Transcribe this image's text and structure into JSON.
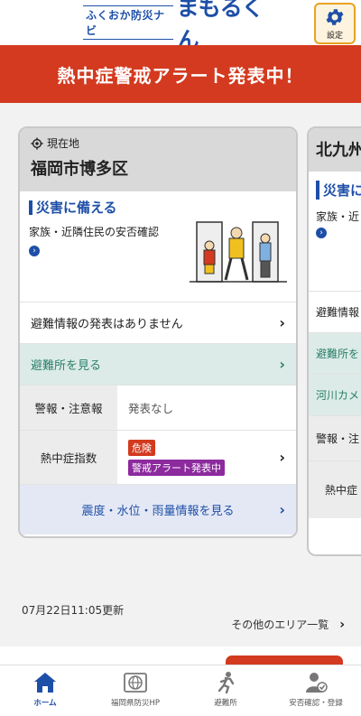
{
  "header": {
    "logo_sub": "ふくおか防災ナビ",
    "logo_main": "まもるくん",
    "settings_label": "設定"
  },
  "alert_banner": "熱中症警戒アラート発表中！",
  "main_card": {
    "location_label": "現在地",
    "city": "福岡市博多区",
    "prepare_title": "災害に備える",
    "family_text": "家族・近隣住民の安否確認",
    "evac_info": "避難情報の発表はありません",
    "shelter": "避難所を見る",
    "warning_label": "警報・注意報",
    "warning_value": "発表なし",
    "heat_label": "熱中症指数",
    "heat_badge_danger": "危険",
    "heat_badge_alert": "警戒アラート発表中",
    "quake_link": "震度・水位・雨量情報を見る"
  },
  "next_card": {
    "city": "北九州",
    "prepare_title": "災害に",
    "family_text": "家族・近",
    "evac_info": "避難情報",
    "shelter": "避難所を",
    "river": "河川カメ",
    "warning_label": "警報・注",
    "heat_label": "熱中症"
  },
  "updated": "07月22日11:05更新",
  "other_areas": "その他のエリア一覧",
  "nav": [
    {
      "label": "ホーム",
      "icon": "home-icon",
      "active": true
    },
    {
      "label": "福岡県防災HP",
      "icon": "globe-icon",
      "active": false
    },
    {
      "label": "避難所",
      "icon": "running-person-icon",
      "active": false
    },
    {
      "label": "安否確認・登録",
      "icon": "person-check-icon",
      "active": false
    }
  ],
  "colors": {
    "brand_blue": "#1e4fa8",
    "alert_red": "#d33a1f",
    "shelter_green": "#2a7f69",
    "alert_purple": "#8c2a9e",
    "settings_orange": "#e8a323"
  }
}
